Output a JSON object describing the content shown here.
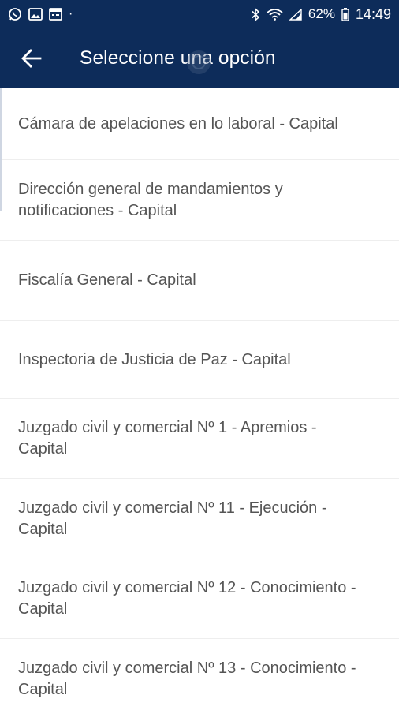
{
  "status_bar": {
    "left_icons": [
      "whatsapp-icon",
      "gallery-icon",
      "calendar-icon"
    ],
    "battery_percent": "62%",
    "time": "14:49",
    "right_icons": [
      "bluetooth-icon",
      "wifi-icon",
      "signal-icon",
      "battery-icon"
    ]
  },
  "app_bar": {
    "back_icon": "arrow-left-icon",
    "title": "Seleccione una opción"
  },
  "colors": {
    "primary": "#0d2c5a",
    "text": "#555555",
    "divider": "#eeeeee"
  },
  "options": [
    {
      "label": "Cámara de apelaciones en lo laboral - Capital"
    },
    {
      "label": "Dirección general de mandamientos y notificaciones - Capital"
    },
    {
      "label": "Fiscalía General - Capital"
    },
    {
      "label": "Inspectoria de Justicia de Paz - Capital"
    },
    {
      "label": "Juzgado civil y comercial Nº 1 - Apremios - Capital"
    },
    {
      "label": "Juzgado civil y comercial Nº 11 - Ejecución - Capital"
    },
    {
      "label": "Juzgado civil y comercial Nº 12 - Conocimiento - Capital"
    },
    {
      "label": "Juzgado civil y comercial Nº 13 - Conocimiento - Capital"
    }
  ]
}
